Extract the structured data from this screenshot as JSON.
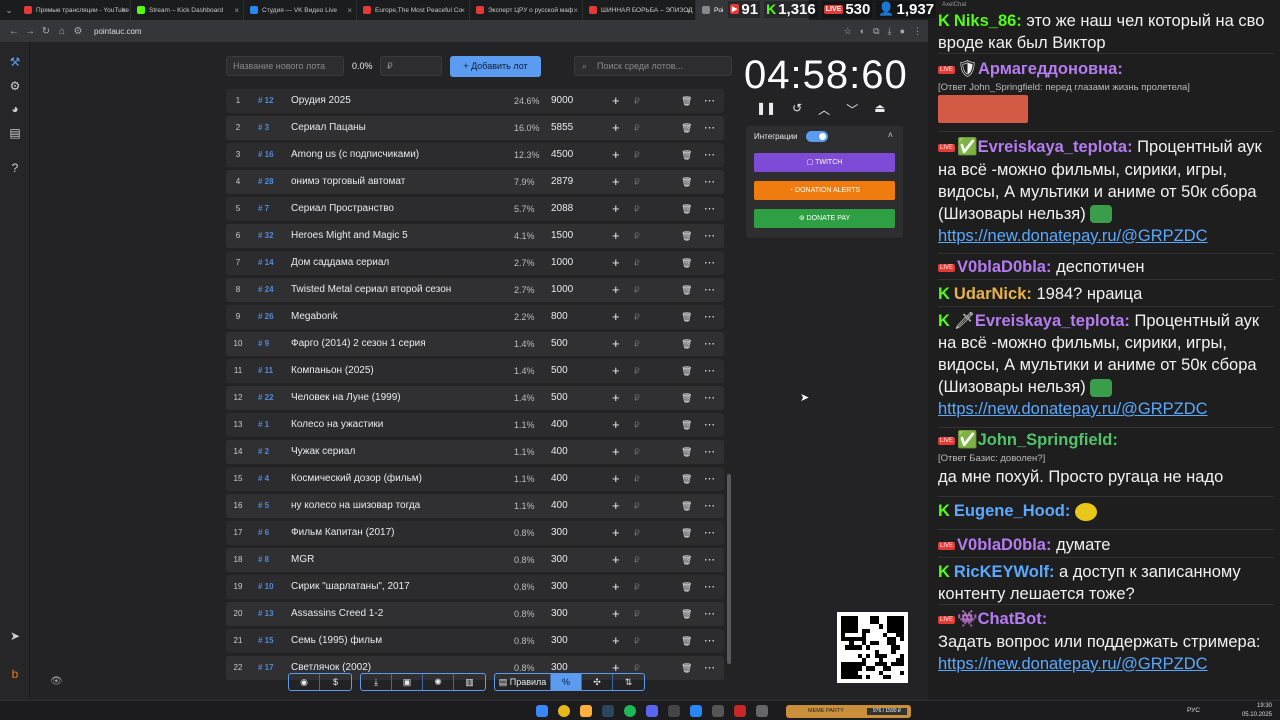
{
  "browser": {
    "tabs": [
      {
        "title": "Прямые трансляции - YouTube",
        "color": "#e53935"
      },
      {
        "title": "Stream – Kick Dashboard",
        "color": "#53fc18"
      },
      {
        "title": "Студия — VK Видео Live",
        "color": "#2787f5"
      },
      {
        "title": "Europe,The Most Peaceful Co",
        "color": "#e53935"
      },
      {
        "title": "Эксперт ЦРУ о русской маф",
        "color": "#e53935"
      },
      {
        "title": "ШИННАЯ БОРЬБА – ЭПИЗОД",
        "color": "#e53935"
      },
      {
        "title": "Poi",
        "color": "#888888"
      }
    ],
    "url": "pointauc.com"
  },
  "stream_stats": {
    "youtube_viewers": "91",
    "kick_viewers": "1,316",
    "vk_viewers": "530",
    "total_viewers": "1,937"
  },
  "toolbar": {
    "new_lot_placeholder": "Название нового лота",
    "percent": "0.0%",
    "amount_placeholder": "₽",
    "add_label": "Добавить лот",
    "search_placeholder": "Поиск среди лотов..."
  },
  "lots": [
    {
      "n": "1",
      "id": "# 12",
      "name": "Орудия 2025",
      "pct": "24.6%",
      "amount": "9000"
    },
    {
      "n": "2",
      "id": "# 3",
      "name": "Сериал Пацаны",
      "pct": "16.0%",
      "amount": "5855"
    },
    {
      "n": "3",
      "id": "# 16",
      "name": "Among us (с подписчиками)",
      "pct": "12.3%",
      "amount": "4500"
    },
    {
      "n": "4",
      "id": "# 28",
      "name": "онимэ торговый автомат",
      "pct": "7.9%",
      "amount": "2879"
    },
    {
      "n": "5",
      "id": "# 7",
      "name": "Сериал Пространство",
      "pct": "5.7%",
      "amount": "2088"
    },
    {
      "n": "6",
      "id": "# 32",
      "name": "Heroes Might and Magic 5",
      "pct": "4.1%",
      "amount": "1500"
    },
    {
      "n": "7",
      "id": "# 14",
      "name": "Дом саддама сериал",
      "pct": "2.7%",
      "amount": "1000"
    },
    {
      "n": "8",
      "id": "# 24",
      "name": "Twisted Metal сериал второй сезон",
      "pct": "2.7%",
      "amount": "1000"
    },
    {
      "n": "9",
      "id": "# 26",
      "name": "Megabonk",
      "pct": "2.2%",
      "amount": "800"
    },
    {
      "n": "10",
      "id": "# 9",
      "name": "Фарго (2014) 2 сезон 1 серия",
      "pct": "1.4%",
      "amount": "500"
    },
    {
      "n": "11",
      "id": "# 11",
      "name": "Компаньон (2025)",
      "pct": "1.4%",
      "amount": "500"
    },
    {
      "n": "12",
      "id": "# 22",
      "name": "Человек на Луне (1999)",
      "pct": "1.4%",
      "amount": "500"
    },
    {
      "n": "13",
      "id": "# 1",
      "name": "Колесо на ужастики",
      "pct": "1.1%",
      "amount": "400"
    },
    {
      "n": "14",
      "id": "# 2",
      "name": "Чужак сериал",
      "pct": "1.1%",
      "amount": "400"
    },
    {
      "n": "15",
      "id": "# 4",
      "name": "Космический дозор (фильм)",
      "pct": "1.1%",
      "amount": "400"
    },
    {
      "n": "16",
      "id": "# 5",
      "name": "ну колесо на шизовар тогда",
      "pct": "1.1%",
      "amount": "400"
    },
    {
      "n": "17",
      "id": "# 6",
      "name": "Фильм Капитан (2017)",
      "pct": "0.8%",
      "amount": "300"
    },
    {
      "n": "18",
      "id": "# 8",
      "name": "MGR",
      "pct": "0.8%",
      "amount": "300"
    },
    {
      "n": "19",
      "id": "# 10",
      "name": "Сирик \"шарлатаны\", 2017",
      "pct": "0.8%",
      "amount": "300"
    },
    {
      "n": "20",
      "id": "# 13",
      "name": "Assassins Creed 1-2",
      "pct": "0.8%",
      "amount": "300"
    },
    {
      "n": "21",
      "id": "# 15",
      "name": "Семь (1995) фильм",
      "pct": "0.8%",
      "amount": "300"
    },
    {
      "n": "22",
      "id": "# 17",
      "name": "Светлячок (2002)",
      "pct": "0.8%",
      "amount": "300"
    }
  ],
  "lot_controls": {
    "plus": "+",
    "currency": "₽",
    "trash": "🗑",
    "more": "⋯"
  },
  "bottom_toolbar": {
    "rules_label": "Правила",
    "percent_label": "%"
  },
  "timer": {
    "value": "04:58:60"
  },
  "integrations": {
    "title": "Интеграции",
    "twitch": "TWITCH",
    "donation_alerts": "DONATION ALERTS",
    "donate_pay": "DONATE PAY"
  },
  "chat": {
    "title": "AxelChat",
    "messages": [
      {
        "user": "Niks_86:",
        "user_color": "#53fc18",
        "text": "это же наш чел который на сво вроде как был Виктор"
      },
      {
        "user": "Армагеддоновна:",
        "user_color": "#b57cf0",
        "reply": "[Ответ John_Springfield: перед глазами жизнь пролетела]"
      },
      {
        "user": "Evreiskaya_teplota:",
        "user_color": "#b57cf0",
        "text": "Процентный аук на всё -можно фильмы, сирики, игры, видосы, А мультики и аниме от 50к сбора (Шизовары нельзя)",
        "link": "https://new.donatepay.ru/@GRPZDC"
      },
      {
        "user": "V0blaD0bla:",
        "user_color": "#b57cf0",
        "text": "деспотичен"
      },
      {
        "user": "UdarNick:",
        "user_color": "#e8b34b",
        "text": "1984? нраица"
      },
      {
        "user": "Evreiskaya_teplota:",
        "user_color": "#b57cf0",
        "text": "Процентный аук на всё -можно фильмы, сирики, игры, видосы, А мультики и аниме от 50к сбора (Шизовары нельзя)",
        "link": "https://new.donatepay.ru/@GRPZDC"
      },
      {
        "user": "John_Springfield:",
        "user_color": "#4fc46a",
        "reply": "[Ответ Базис: доволен?]",
        "text": "да мне похуй. Просто ругаца не надо"
      },
      {
        "user": "Eugene_Hood:",
        "user_color": "#5aa9ff"
      },
      {
        "user": "V0blaD0bla:",
        "user_color": "#b57cf0",
        "text": "думате"
      },
      {
        "user": "RicKEYWolf:",
        "user_color": "#5aa9ff",
        "text": "а доступ к записанному контенту лешается тоже?"
      },
      {
        "user": "ChatBot:",
        "user_color": "#b57cf0",
        "text": "Задать вопрос или поддержать стримера:",
        "link": "https://new.donatepay.ru/@GRPZDC"
      }
    ]
  },
  "taskbar": {
    "lang": "РУС",
    "time": "19:30",
    "date": "05.10.2025",
    "meme_label": "MEME PARTY",
    "meme_counter": "976 / 1590 ₽"
  }
}
